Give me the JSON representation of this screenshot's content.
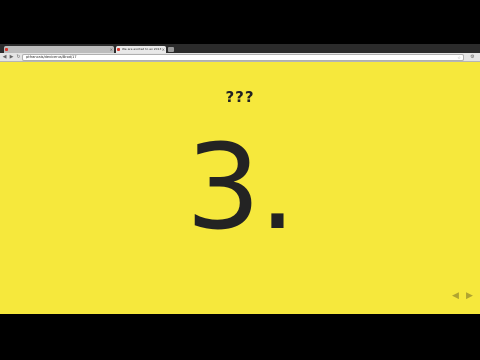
{
  "browser": {
    "tabs": [
      {
        "label": ""
      },
      {
        "label": "We are excited to ex 2013"
      }
    ],
    "url": "ptfrancais/devicerus/Brod/17",
    "colors": {
      "slide_bg": "#f6e83c",
      "text": "#232323"
    }
  },
  "slide": {
    "kicker": "???",
    "number": "3."
  },
  "nav": {
    "prev_icon": "◀",
    "next_icon": "▶"
  }
}
